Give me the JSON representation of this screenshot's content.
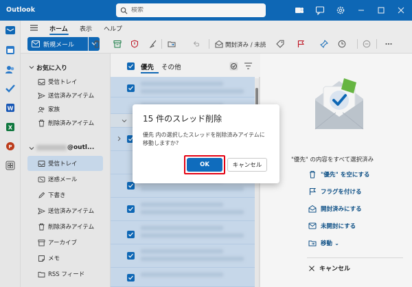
{
  "app": {
    "title": "Outlook"
  },
  "search": {
    "placeholder": "検索"
  },
  "ribbon": {
    "tabs": [
      {
        "label": "ホーム",
        "active": true
      },
      {
        "label": "表示",
        "active": false
      },
      {
        "label": "ヘルプ",
        "active": false
      }
    ],
    "new_mail_label": "新規メール",
    "mark_read_label": "開封済み / 未読"
  },
  "folders": {
    "favorites_header": "お気に入り",
    "favorites": [
      {
        "label": "受信トレイ",
        "icon": "inbox-icon"
      },
      {
        "label": "送信済みアイテム",
        "icon": "send-icon"
      },
      {
        "label": "家族",
        "icon": "people-icon"
      },
      {
        "label": "削除済みアイテム",
        "icon": "trash-icon"
      }
    ],
    "account_header": "@outl...",
    "account_items": [
      {
        "label": "受信トレイ",
        "icon": "inbox-icon",
        "selected": true
      },
      {
        "label": "迷惑メール",
        "icon": "junk-icon"
      },
      {
        "label": "下書き",
        "icon": "pencil-icon"
      },
      {
        "label": "送信済みアイテム",
        "icon": "send-icon"
      },
      {
        "label": "削除済みアイテム",
        "icon": "trash-icon"
      },
      {
        "label": "アーカイブ",
        "icon": "archive-icon"
      },
      {
        "label": "メモ",
        "icon": "note-icon"
      },
      {
        "label": "RSS フィード",
        "icon": "folder-icon"
      }
    ]
  },
  "message_list": {
    "tabs": [
      {
        "label": "優先",
        "active": true
      },
      {
        "label": "その他",
        "active": false
      }
    ]
  },
  "reading_pane": {
    "title": "\"優先\" の内容をすべて選択済み",
    "actions": [
      {
        "label": "\"優先\" を空にする",
        "icon": "trash-icon"
      },
      {
        "label": "フラグを付ける",
        "icon": "flag-icon"
      },
      {
        "label": "開封済みにする",
        "icon": "mail-open-icon"
      },
      {
        "label": "未開封にする",
        "icon": "mail-icon"
      },
      {
        "label": "移動 ⌄",
        "icon": "move-folder-icon"
      }
    ],
    "cancel_label": "キャンセル"
  },
  "dialog": {
    "title": "15 件のスレッド削除",
    "body": "優先 内の選択したスレッドを削除済みアイテムに移動しますか?",
    "ok_label": "OK",
    "cancel_label": "キャンセル"
  },
  "colors": {
    "brand": "#0f6cbd",
    "selection": "#cfe0f3",
    "highlight": "#e40012"
  }
}
